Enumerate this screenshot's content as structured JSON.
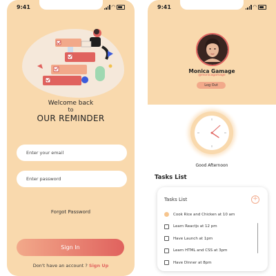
{
  "status_bar": {
    "time": "9:41"
  },
  "login": {
    "welcome_line1": "Welcome back",
    "welcome_line2": "to",
    "app_name": "OUR REMINDER",
    "email_placeholder": "Enter your email",
    "password_placeholder": "Enter password",
    "forgot_password": "Forgot Password",
    "sign_in": "Sign In",
    "no_account": "Don't have an account ?",
    "sign_up": "Sign Up"
  },
  "profile": {
    "name": "Monica Gamage",
    "handle": "@monicagamage",
    "logout": "Log Out"
  },
  "clock": {
    "hour": 4,
    "minute": 8
  },
  "greeting": "Good Afternoon",
  "tasks": {
    "section_title": "Tasks List",
    "card_title": "Tasks List",
    "items": [
      {
        "label": "Cook Rice and Chicken at 10 am",
        "done": true
      },
      {
        "label": "Learn Reactjs at 12 pm",
        "done": false
      },
      {
        "label": "Have Launch  at 1pm",
        "done": false
      },
      {
        "label": "Learn HTML and CSS at 3pm",
        "done": false
      },
      {
        "label": "Have Dinner at 8pm",
        "done": false
      }
    ]
  },
  "colors": {
    "background": "#f9d9ad",
    "accent": "#e0625e",
    "accent_light": "#f2a98a"
  }
}
